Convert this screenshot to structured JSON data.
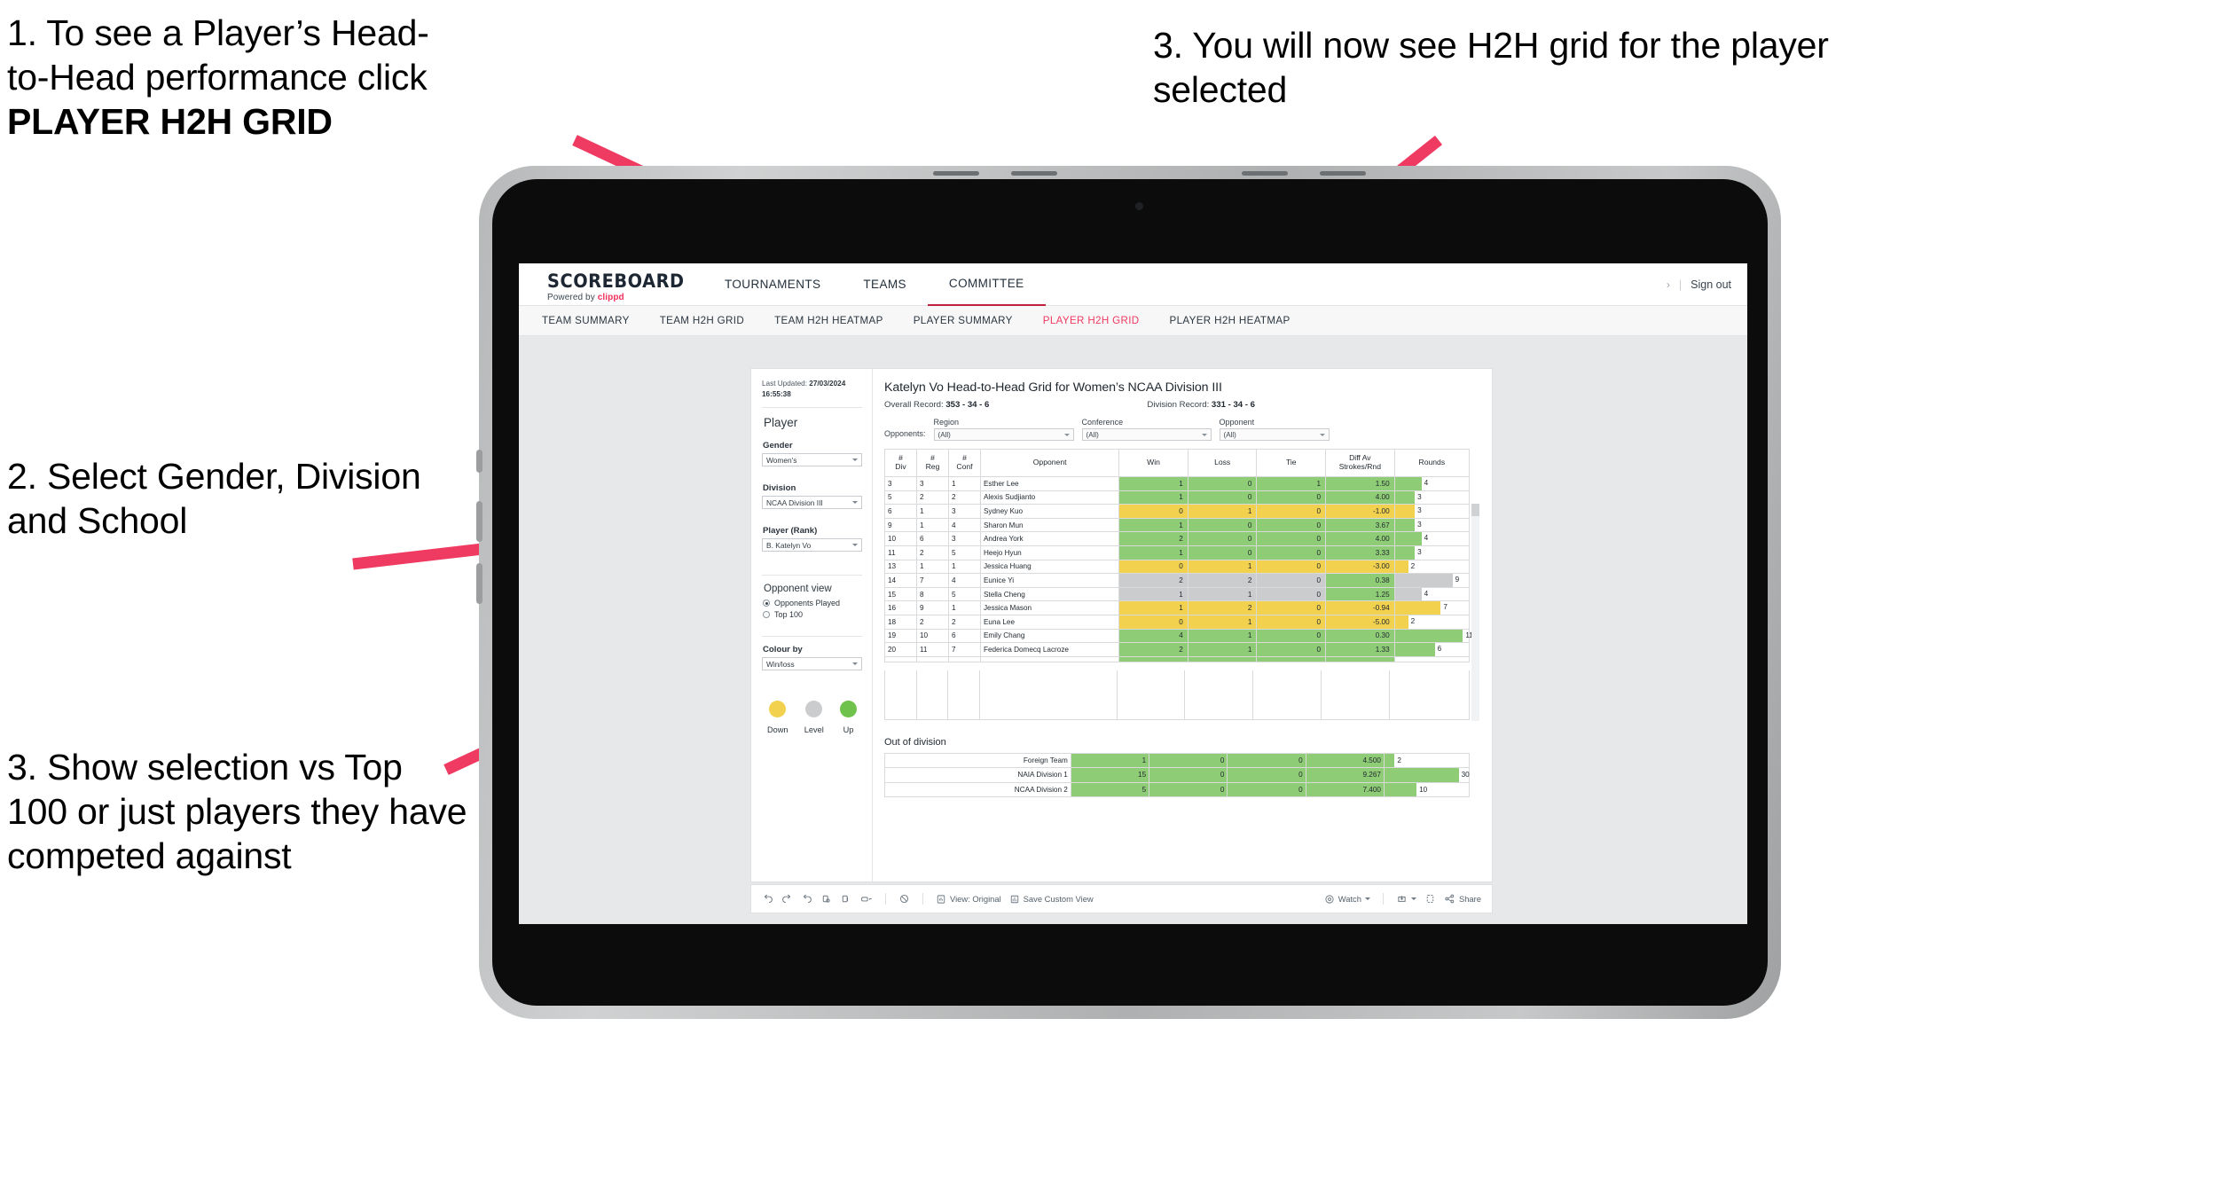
{
  "annotations": {
    "a1_line1": "1. To see a Player’s Head-",
    "a1_line2": "to-Head performance click",
    "a1_bold": "PLAYER H2H GRID",
    "a2": "2. Select Gender, Division and School",
    "a3": "3. Show selection vs Top 100 or just players they have competed against",
    "a4": "3. You will now see H2H grid for the player selected"
  },
  "brand": {
    "name": "SCOREBOARD",
    "powered_prefix": "Powered by ",
    "powered_by": "clippd"
  },
  "topnav": {
    "items": [
      "TOURNAMENTS",
      "TEAMS",
      "COMMITTEE"
    ],
    "active": "COMMITTEE",
    "sign_out": "Sign out",
    "separator": "|",
    "chevron": "›"
  },
  "subnav": {
    "items": [
      "TEAM SUMMARY",
      "TEAM H2H GRID",
      "TEAM H2H HEATMAP",
      "PLAYER SUMMARY",
      "PLAYER H2H GRID",
      "PLAYER H2H HEATMAP"
    ],
    "active": "PLAYER H2H GRID"
  },
  "sidebar": {
    "last_updated_label": "Last Updated: ",
    "last_updated_date": "27/03/2024",
    "last_updated_time": "16:55:38",
    "player_heading": "Player",
    "gender_label": "Gender",
    "gender_value": "Women's",
    "division_label": "Division",
    "division_value": "NCAA Division III",
    "player_rank_label": "Player (Rank)",
    "player_rank_value": "B. Katelyn Vo",
    "opponent_view_heading": "Opponent view",
    "opponents_played": "Opponents Played",
    "top_100": "Top 100",
    "colour_by_label": "Colour by",
    "colour_by_value": "Win/loss",
    "legend": [
      {
        "label": "Down",
        "color": "#f2d14f"
      },
      {
        "label": "Level",
        "color": "#cbccce"
      },
      {
        "label": "Up",
        "color": "#8fcc76"
      }
    ]
  },
  "view": {
    "title": "Katelyn Vo Head-to-Head Grid for Women’s NCAA Division III",
    "overall_record_label": "Overall Record: ",
    "overall_record": "353 -  34 - 6",
    "division_record_label": "Division Record: ",
    "division_record": "331 -  34 - 6",
    "opponents_label": "Opponents:",
    "filters": [
      {
        "name": "Region",
        "value": "(All)"
      },
      {
        "name": "Conference",
        "value": "(All)"
      },
      {
        "name": "Opponent",
        "value": "(All)"
      }
    ]
  },
  "chart_data": {
    "type": "table",
    "title": "Katelyn Vo Head-to-Head Grid for Women’s NCAA Division III",
    "columns": [
      "# Div",
      "# Reg",
      "# Conf",
      "Opponent",
      "Win",
      "Loss",
      "Tie",
      "Diff Av Strokes/Rnd",
      "Rounds"
    ],
    "rows": [
      {
        "div": "3",
        "reg": "3",
        "conf": "1",
        "opponent": "Esther Lee",
        "win": "1",
        "loss": "0",
        "tie": "1",
        "diff": "1.50",
        "rounds": "4",
        "state": "up",
        "bar_pct": 36
      },
      {
        "div": "5",
        "reg": "2",
        "conf": "2",
        "opponent": "Alexis Sudjianto",
        "win": "1",
        "loss": "0",
        "tie": "0",
        "diff": "4.00",
        "rounds": "3",
        "state": "up",
        "bar_pct": 27
      },
      {
        "div": "6",
        "reg": "1",
        "conf": "3",
        "opponent": "Sydney Kuo",
        "win": "0",
        "loss": "1",
        "tie": "0",
        "diff": "-1.00",
        "rounds": "3",
        "state": "down",
        "bar_pct": 27
      },
      {
        "div": "9",
        "reg": "1",
        "conf": "4",
        "opponent": "Sharon Mun",
        "win": "1",
        "loss": "0",
        "tie": "0",
        "diff": "3.67",
        "rounds": "3",
        "state": "up",
        "bar_pct": 27
      },
      {
        "div": "10",
        "reg": "6",
        "conf": "3",
        "opponent": "Andrea York",
        "win": "2",
        "loss": "0",
        "tie": "0",
        "diff": "4.00",
        "rounds": "4",
        "state": "up",
        "bar_pct": 36
      },
      {
        "div": "11",
        "reg": "2",
        "conf": "5",
        "opponent": "Heejo Hyun",
        "win": "1",
        "loss": "0",
        "tie": "0",
        "diff": "3.33",
        "rounds": "3",
        "state": "up",
        "bar_pct": 27
      },
      {
        "div": "13",
        "reg": "1",
        "conf": "1",
        "opponent": "Jessica Huang",
        "win": "0",
        "loss": "1",
        "tie": "0",
        "diff": "-3.00",
        "rounds": "2",
        "state": "down",
        "bar_pct": 18
      },
      {
        "div": "14",
        "reg": "7",
        "conf": "4",
        "opponent": "Eunice Yi",
        "win": "2",
        "loss": "2",
        "tie": "0",
        "diff": "0.38",
        "rounds": "9",
        "state": "level",
        "bar_pct": 78,
        "diff_state": "up"
      },
      {
        "div": "15",
        "reg": "8",
        "conf": "5",
        "opponent": "Stella Cheng",
        "win": "1",
        "loss": "1",
        "tie": "0",
        "diff": "1.25",
        "rounds": "4",
        "state": "level",
        "bar_pct": 36,
        "diff_state": "up"
      },
      {
        "div": "16",
        "reg": "9",
        "conf": "1",
        "opponent": "Jessica Mason",
        "win": "1",
        "loss": "2",
        "tie": "0",
        "diff": "-0.94",
        "rounds": "7",
        "state": "down",
        "bar_pct": 62
      },
      {
        "div": "18",
        "reg": "2",
        "conf": "2",
        "opponent": "Euna Lee",
        "win": "0",
        "loss": "1",
        "tie": "0",
        "diff": "-5.00",
        "rounds": "2",
        "state": "down",
        "bar_pct": 18
      },
      {
        "div": "19",
        "reg": "10",
        "conf": "6",
        "opponent": "Emily Chang",
        "win": "4",
        "loss": "1",
        "tie": "0",
        "diff": "0.30",
        "rounds": "11",
        "state": "up",
        "bar_pct": 92
      },
      {
        "div": "20",
        "reg": "11",
        "conf": "7",
        "opponent": "Federica Domecq Lacroze",
        "win": "2",
        "loss": "1",
        "tie": "0",
        "diff": "1.33",
        "rounds": "6",
        "state": "up",
        "bar_pct": 54
      }
    ]
  },
  "out_of_division": {
    "heading": "Out of division",
    "rows": [
      {
        "name": "Foreign Team",
        "win": "1",
        "loss": "0",
        "tie": "0",
        "diff": "4.500",
        "rounds": "2",
        "state": "up",
        "bar_pct": 12
      },
      {
        "name": "NAIA Division 1",
        "win": "15",
        "loss": "0",
        "tie": "0",
        "diff": "9.267",
        "rounds": "30",
        "state": "up",
        "bar_pct": 88
      },
      {
        "name": "NCAA Division 2",
        "win": "5",
        "loss": "0",
        "tie": "0",
        "diff": "7.400",
        "rounds": "10",
        "state": "up",
        "bar_pct": 38
      }
    ]
  },
  "toolbar": {
    "view_original": "View: Original",
    "save_custom_view": "Save Custom View",
    "watch": "Watch",
    "share": "Share"
  }
}
